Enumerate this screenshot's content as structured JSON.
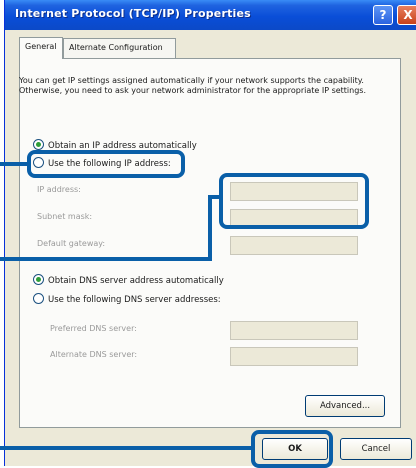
{
  "window": {
    "title": "Internet Protocol (TCP/IP) Properties",
    "help_glyph": "?",
    "close_glyph": "X"
  },
  "tabs": [
    {
      "label": "General",
      "active": true
    },
    {
      "label": "Alternate Configuration",
      "active": false
    }
  ],
  "description": "You can get IP settings assigned automatically if your network supports the capability. Otherwise, you need to ask your network administrator for the appropriate IP settings.",
  "ip": {
    "auto_label": "Obtain an IP address automatically",
    "manual_label": "Use the following IP address:",
    "selected": "auto",
    "fields": [
      {
        "label": "IP address:",
        "value": ""
      },
      {
        "label": "Subnet mask:",
        "value": ""
      },
      {
        "label": "Default gateway:",
        "value": ""
      }
    ]
  },
  "dns": {
    "auto_label": "Obtain DNS server address automatically",
    "manual_label": "Use the following DNS server addresses:",
    "selected": "auto",
    "fields": [
      {
        "label": "Preferred DNS server:",
        "value": ""
      },
      {
        "label": "Alternate DNS server:",
        "value": ""
      }
    ]
  },
  "buttons": {
    "advanced": "Advanced...",
    "ok": "OK",
    "cancel": "Cancel"
  },
  "colors": {
    "titlebar": "#0a4ed8",
    "highlight": "#0a5fa8",
    "dialog_bg": "#ece9d8"
  }
}
